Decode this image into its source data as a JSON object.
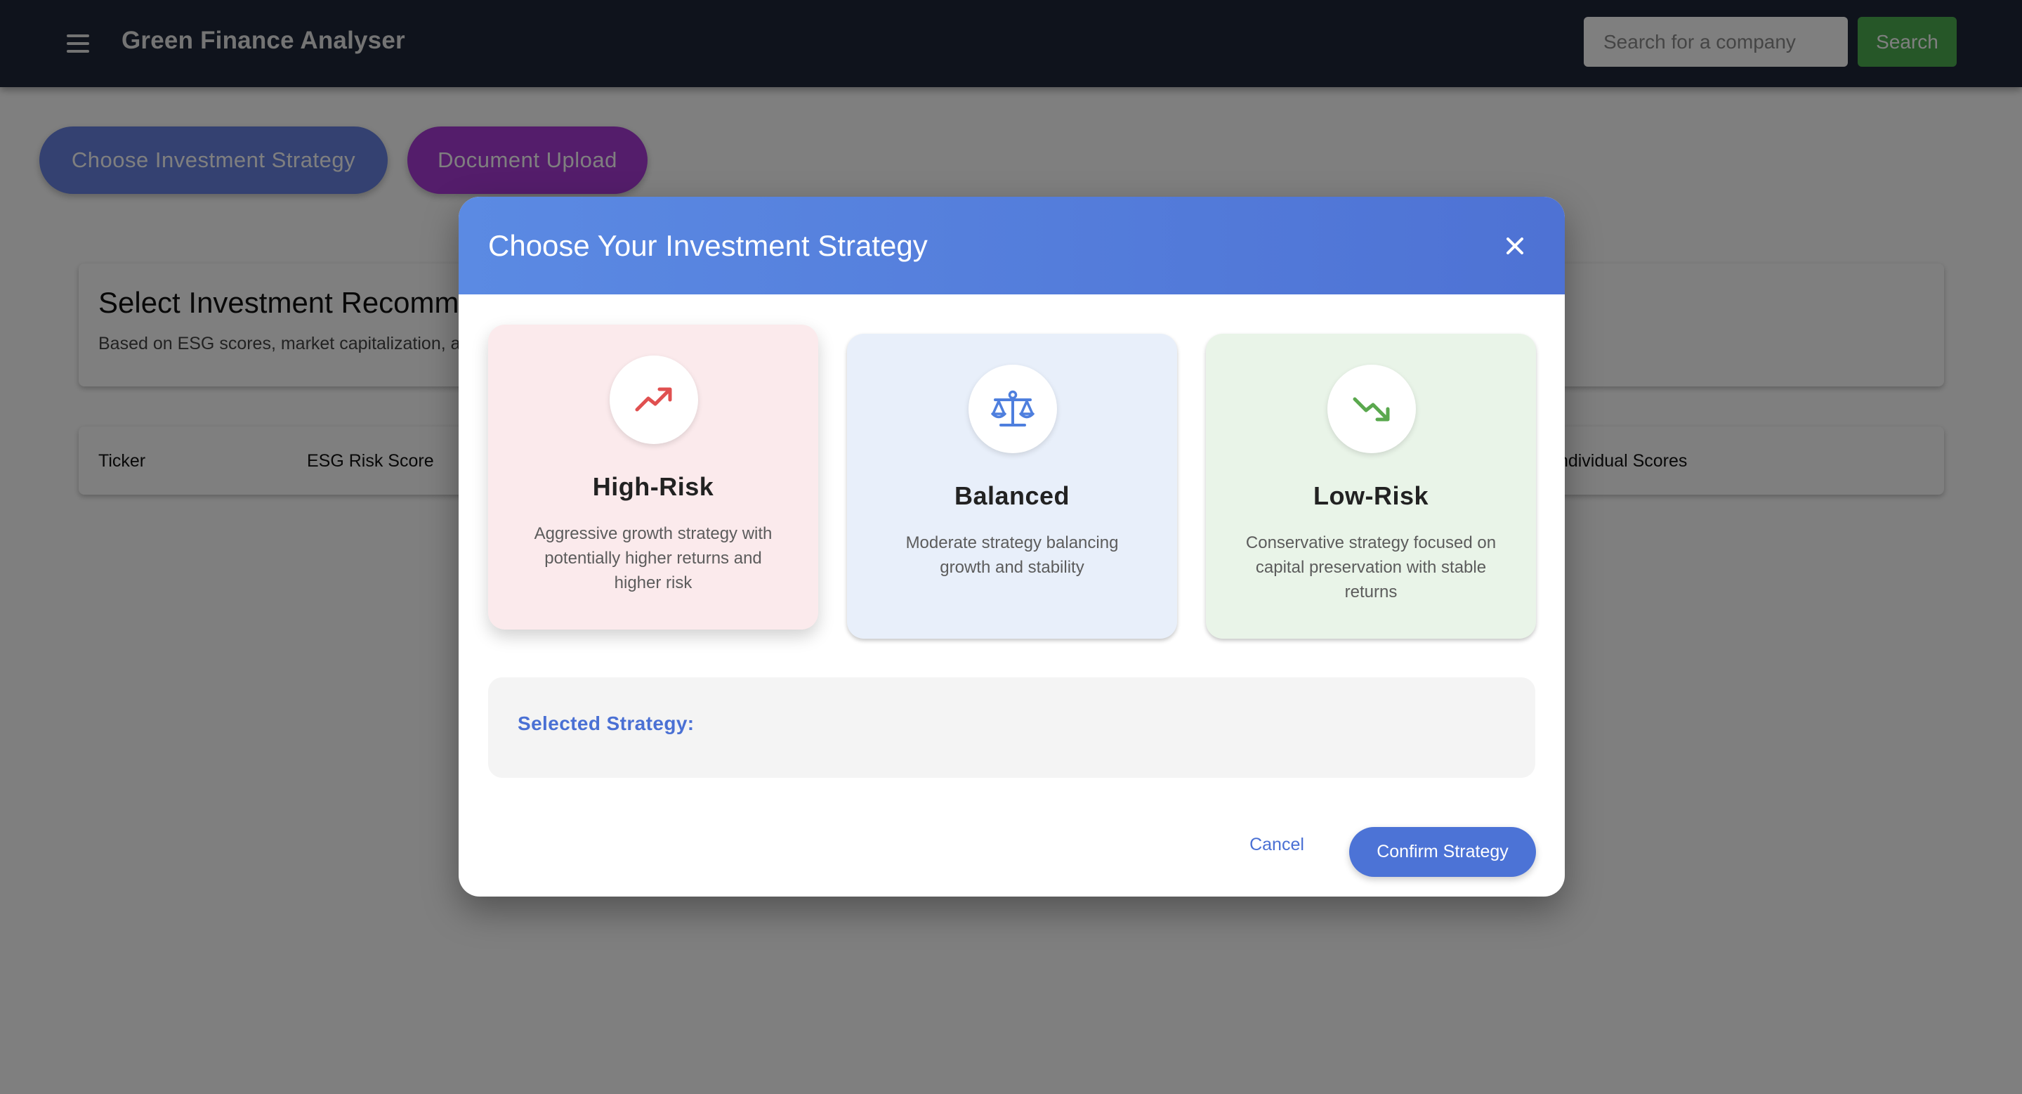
{
  "header": {
    "app_title": "Green Finance Analyser",
    "search_placeholder": "Search for a company",
    "search_label": "Search"
  },
  "actions": {
    "choose_strategy": "Choose Investment Strategy",
    "document_upload": "Document Upload"
  },
  "recommendations": {
    "title": "Select Investment Recommendations",
    "subtitle": "Based on ESG scores, market capitalization, and"
  },
  "table": {
    "columns": [
      "Ticker",
      "ESG Risk Score",
      "Individual Scores"
    ]
  },
  "modal": {
    "title": "Choose Your Investment Strategy",
    "strategies": [
      {
        "name": "High-Risk",
        "description": "Aggressive growth strategy with potentially higher returns and higher risk",
        "icon": "trending-up-icon",
        "color": "#e05050"
      },
      {
        "name": "Balanced",
        "description": "Moderate strategy balancing growth and stability",
        "icon": "balance-scale-icon",
        "color": "#4e7fde"
      },
      {
        "name": "Low-Risk",
        "description": "Conservative strategy focused on capital preservation with stable returns",
        "icon": "trending-down-icon",
        "color": "#5aa84e"
      }
    ],
    "selected_label": "Selected Strategy:",
    "cancel_label": "Cancel",
    "confirm_label": "Confirm Strategy"
  },
  "colors": {
    "topbar": "#1f2638",
    "search_button": "#4caf50",
    "strategy_pill": "#6883e3",
    "upload_pill": "#a93ad6",
    "modal_header": "#5b8ae3",
    "primary": "#4c73d6"
  }
}
